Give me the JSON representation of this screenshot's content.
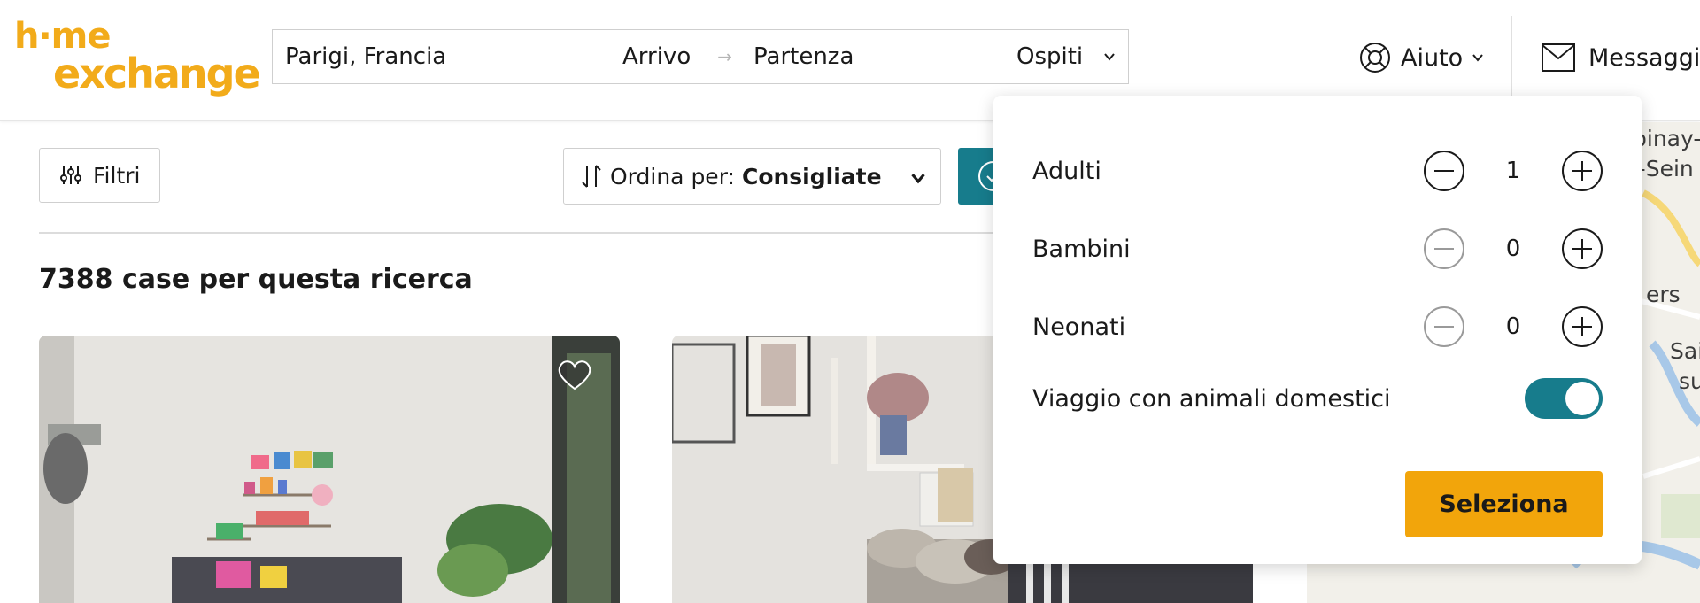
{
  "logo": {
    "line1": "h·me",
    "line2": "exchange",
    "color": "#f2ab1a"
  },
  "search": {
    "location": "Parigi, Francia",
    "arrival": "Arrivo",
    "departure": "Partenza",
    "guests": "Ospiti"
  },
  "nav": {
    "help": "Aiuto",
    "messages": "Messaggi"
  },
  "toolbar": {
    "filters": "Filtri",
    "sort_label": "Ordina per:",
    "sort_value": "Consigliate"
  },
  "results": {
    "count_text": "7388 case per questa ricerca"
  },
  "map": {
    "labels": [
      "pinay-",
      "r-Sein",
      "ers",
      "Sai",
      "su"
    ]
  },
  "guests_dropdown": {
    "rows": [
      {
        "label": "Adulti",
        "value": "1",
        "minus_disabled": false
      },
      {
        "label": "Bambini",
        "value": "0",
        "minus_disabled": true
      },
      {
        "label": "Neonati",
        "value": "0",
        "minus_disabled": true
      }
    ],
    "pets_label": "Viaggio con animali domestici",
    "pets_enabled": true,
    "select_button": "Seleziona"
  },
  "colors": {
    "accent": "#f2a50b",
    "teal": "#177c8c"
  }
}
